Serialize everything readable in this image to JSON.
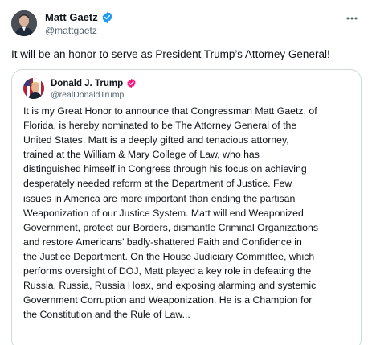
{
  "post": {
    "author_name": "Matt Gaetz",
    "author_handle": "@mattgaetz",
    "verified_color": "#1d9bf0",
    "more_icon": "more-horizontal-icon",
    "text": "It will be an honor to serve as President Trump’s Attorney General!"
  },
  "quote": {
    "author_name": "Donald J. Trump",
    "author_handle": "@realDonaldTrump",
    "badge_color": "#f91880",
    "lines": [
      "It is my Great Honor to announce that Congressman Matt Gaetz, of",
      "Florida, is hereby nominated to be The Attorney General of the",
      "United States. Matt is a deeply gifted and tenacious attorney,",
      "trained at the William & Mary College of Law, who has",
      "distinguished himself in Congress through his focus on achieving",
      "desperately needed reform at the Department of Justice. Few",
      "issues in America are more important than ending the partisan",
      "Weaponization of our Justice System. Matt will end Weaponized",
      "Government, protect our Borders, dismantle Criminal Organizations",
      "and restore Americans’ badly-shattered Faith and Confidence in",
      "the Justice Department. On the House Judiciary Committee, which",
      "performs oversight of DOJ, Matt played a key role in defeating the",
      "Russia, Russia, Russia Hoax, and exposing alarming and systemic",
      "Government Corruption and Weaponization. He is a Champion for",
      "the Constitution and the Rule of Law..."
    ]
  }
}
